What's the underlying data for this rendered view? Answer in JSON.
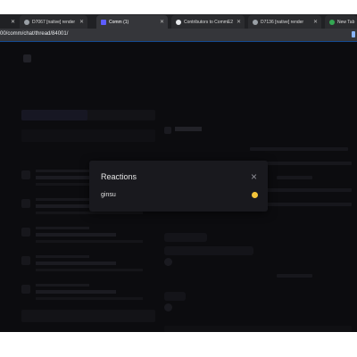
{
  "browser": {
    "tabs": [
      {
        "label": "D7067 [native] render",
        "favicon": "gear-icon",
        "active": false
      },
      {
        "label": "Comm (1)",
        "favicon": "comm-icon",
        "active": true
      },
      {
        "label": "Contributors to CommE2E",
        "favicon": "github-icon",
        "active": false
      },
      {
        "label": "D7136 [native] render",
        "favicon": "gear-icon",
        "active": false
      },
      {
        "label": "New Tab",
        "favicon": "chrome-icon",
        "active": false
      }
    ],
    "url": "00/comm/chat/thread/84001/"
  },
  "modal": {
    "title": "Reactions",
    "reactions": [
      {
        "user": "ginsu",
        "emoji": "😆"
      }
    ]
  }
}
